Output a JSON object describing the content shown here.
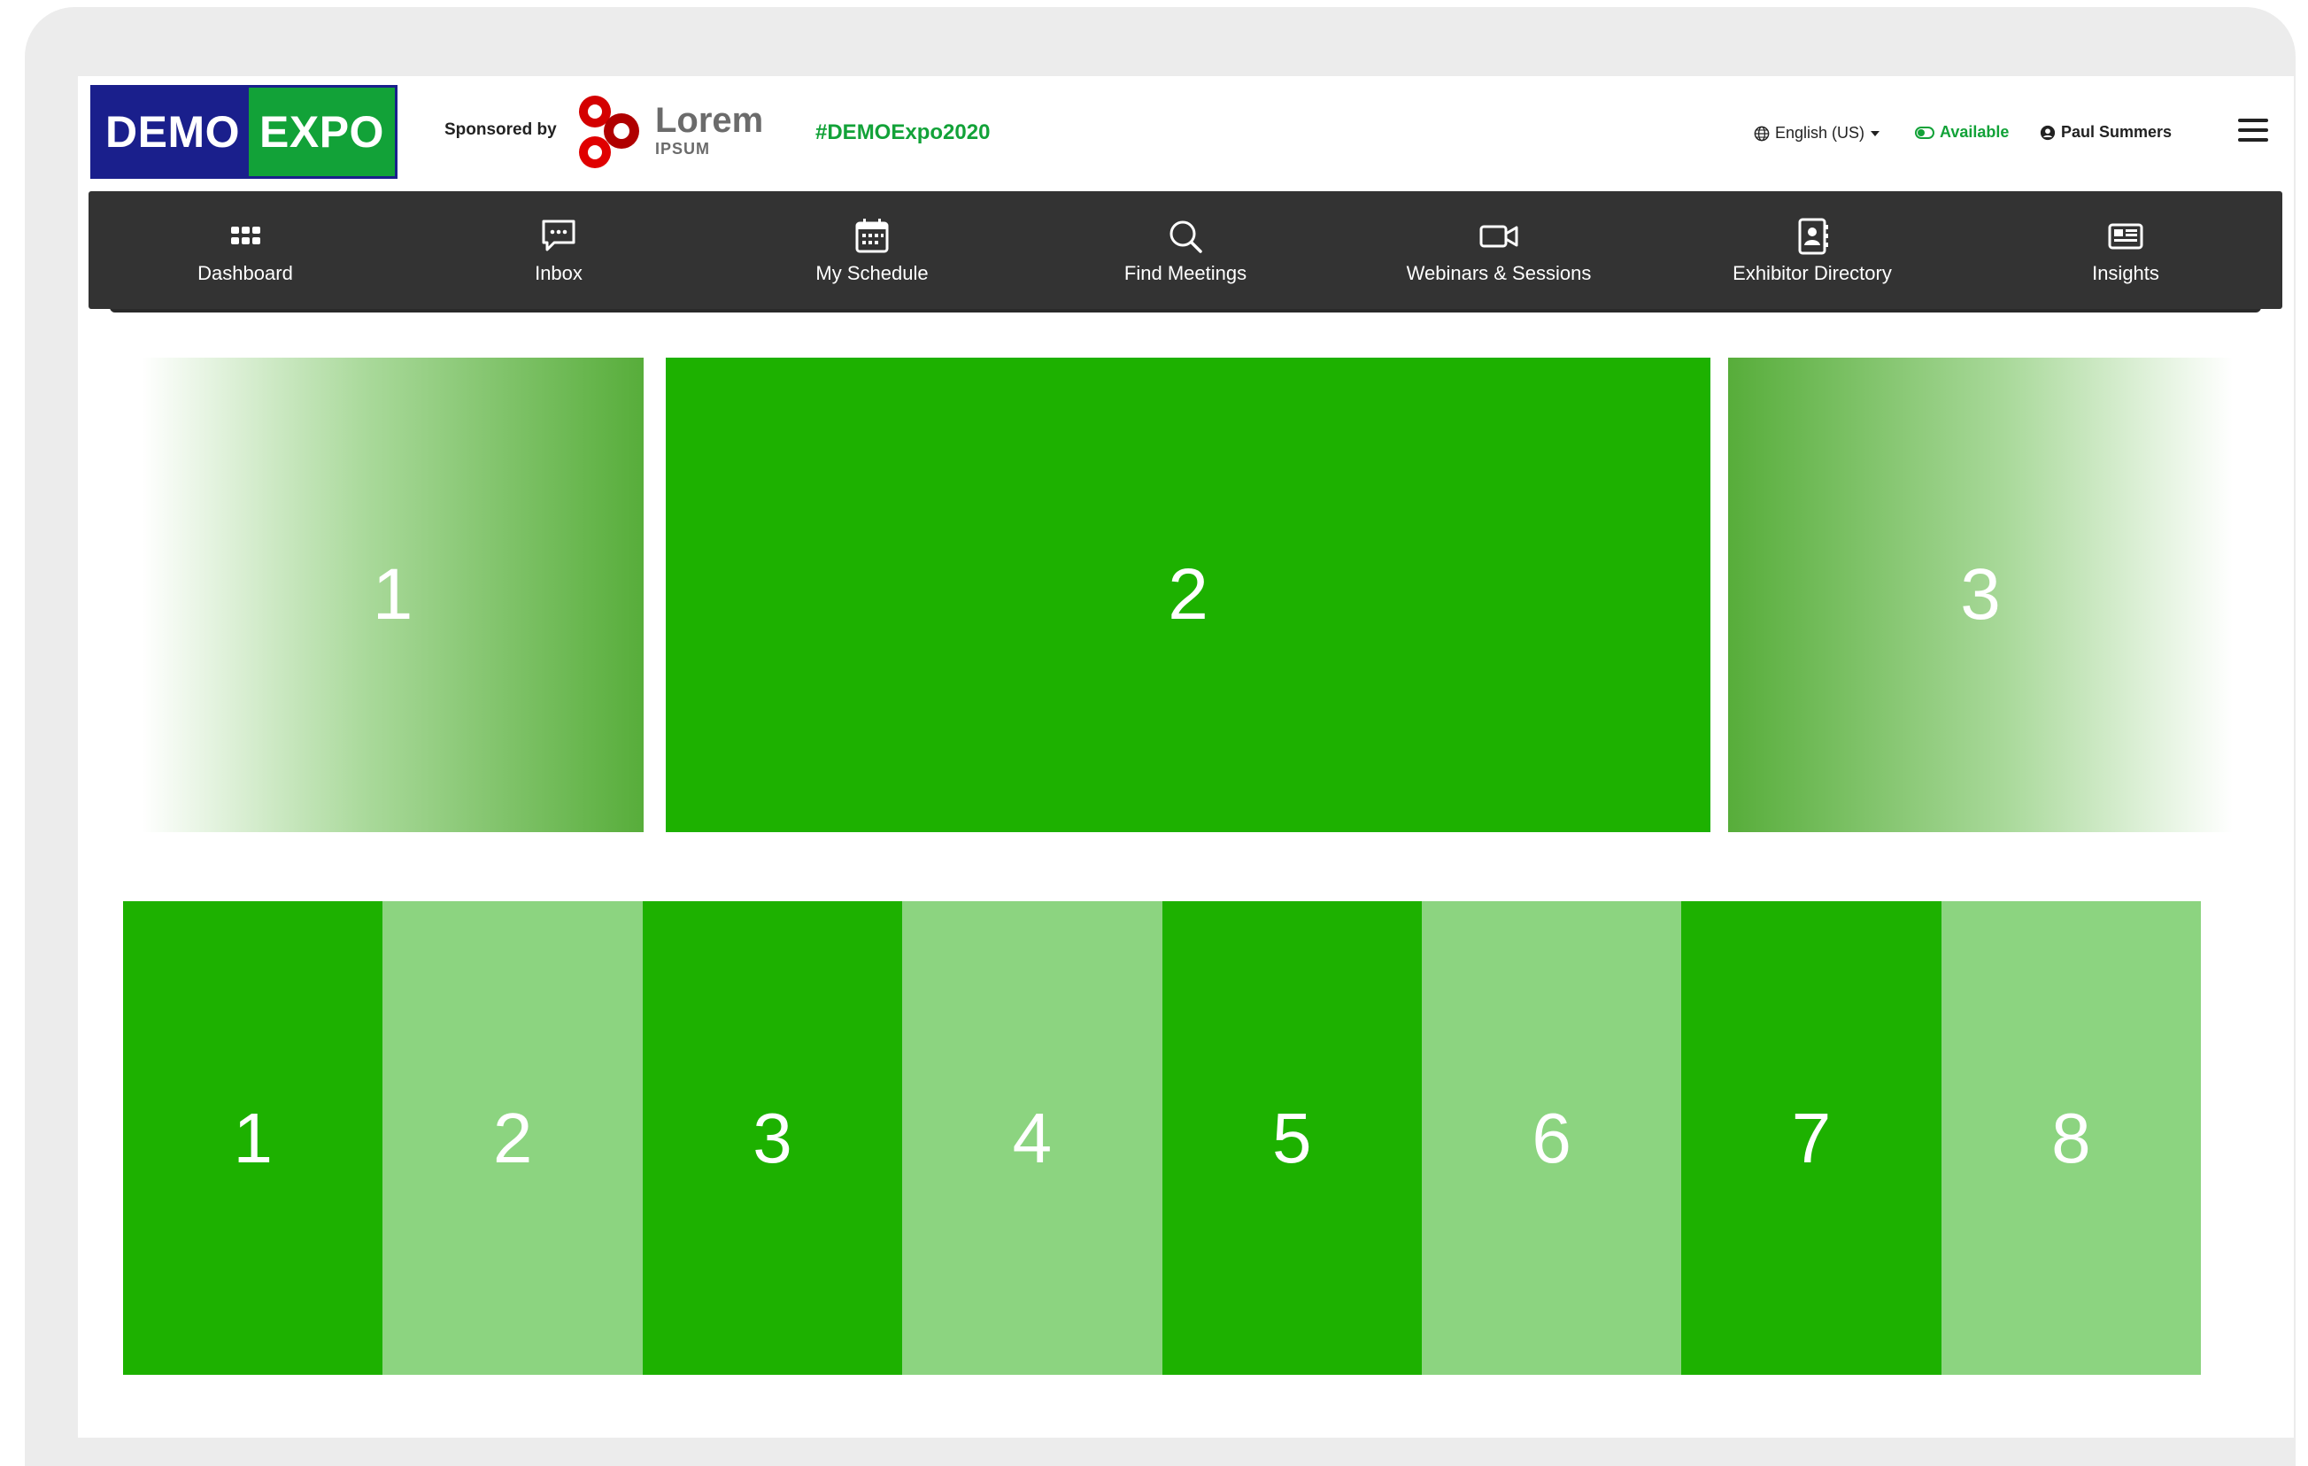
{
  "brand": {
    "logo_left": "DEMO",
    "logo_right": "EXPO"
  },
  "sponsor": {
    "label": "Sponsored by",
    "name": "Lorem",
    "sub": "IPSUM"
  },
  "hashtag": "#DEMOExpo2020",
  "header": {
    "language": "English (US)",
    "status": "Available",
    "user": "Paul Summers"
  },
  "nav": [
    {
      "label": "Dashboard",
      "icon": "grid-icon"
    },
    {
      "label": "Inbox",
      "icon": "chat-icon"
    },
    {
      "label": "My Schedule",
      "icon": "calendar-icon"
    },
    {
      "label": "Find Meetings",
      "icon": "search-icon"
    },
    {
      "label": "Webinars & Sessions",
      "icon": "video-camera-icon"
    },
    {
      "label": "Exhibitor Directory",
      "icon": "contact-book-icon"
    },
    {
      "label": "Insights",
      "icon": "newspaper-icon"
    }
  ],
  "carousel": [
    "1",
    "2",
    "3"
  ],
  "tiles": [
    "1",
    "2",
    "3",
    "4",
    "5",
    "6",
    "7",
    "8"
  ],
  "colors": {
    "brand_blue": "#1a1f8c",
    "brand_green": "#12a238",
    "nav_bg": "#333333",
    "slide_green": "#1db100",
    "tile_light": "#8cd480"
  }
}
